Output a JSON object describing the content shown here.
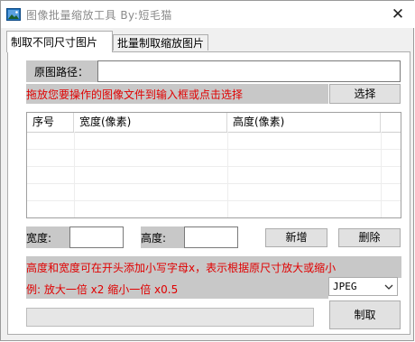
{
  "window": {
    "title": "图像批量缩放工具 By:短毛猫",
    "close_glyph": "✕"
  },
  "tabs": [
    {
      "label": "制取不同尺寸图片",
      "active": true
    },
    {
      "label": "批量制取缩放图片",
      "active": false
    }
  ],
  "source": {
    "label": "原图路径：",
    "value": "",
    "hint": "拖放您要操作的图像文件到输入框或点击选择",
    "select_button": "选择"
  },
  "table": {
    "columns": [
      "序号",
      "宽度(像素)",
      "高度(像素)"
    ],
    "rows": []
  },
  "size_inputs": {
    "width_label": "宽度:",
    "width_value": "",
    "height_label": "高度:",
    "height_value": "",
    "add_button": "新增",
    "delete_button": "删除"
  },
  "notes": {
    "line1": "高度和宽度可在开头添加小写字母x，表示根据原尺寸放大或缩小",
    "line2": "例: 放大一倍 x2 缩小一倍 x0.5"
  },
  "format_select": {
    "value": "JPEG"
  },
  "progress": {
    "value": 0
  },
  "make_button": "制取",
  "colors": {
    "hint_red": "#e00000",
    "label_bg": "#c8c8c8",
    "icon_blue": "#1e6fb8"
  }
}
